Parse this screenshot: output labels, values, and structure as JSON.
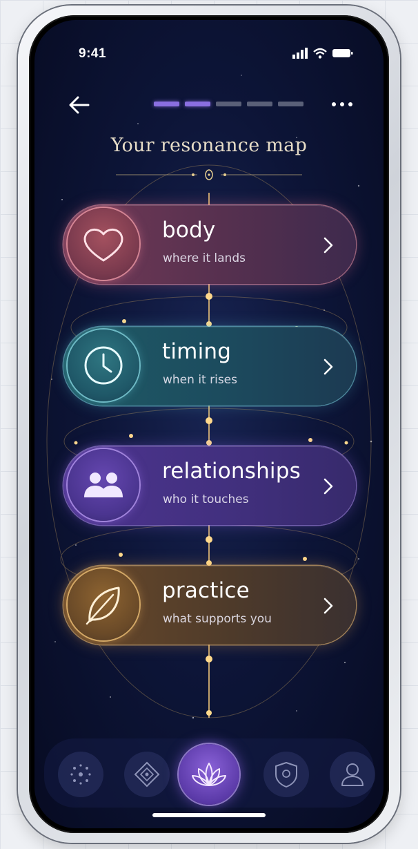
{
  "status_bar": {
    "time": "9:41"
  },
  "header": {
    "title": "Your resonance map",
    "progress": {
      "total_steps": 5,
      "completed_steps": 2
    }
  },
  "cards": [
    {
      "id": "body",
      "title": "body",
      "subtitle": "where it lands",
      "icon": "heart-icon",
      "accent": "#e58fa0"
    },
    {
      "id": "timing",
      "title": "timing",
      "subtitle": "when it rises",
      "icon": "clock-icon",
      "accent": "#7fd3da"
    },
    {
      "id": "relationships",
      "title": "relationships",
      "subtitle": "who it touches",
      "icon": "people-icon",
      "accent": "#b89af0"
    },
    {
      "id": "practice",
      "title": "practice",
      "subtitle": "what supports you",
      "icon": "leaf-icon",
      "accent": "#e6b46e"
    }
  ],
  "tab_bar": {
    "items": [
      {
        "icon": "sparkle-cluster-icon",
        "active": false
      },
      {
        "icon": "compass-diamond-icon",
        "active": false
      },
      {
        "icon": "lotus-icon",
        "active": true
      },
      {
        "icon": "shield-heart-icon",
        "active": false
      },
      {
        "icon": "profile-icon",
        "active": false
      }
    ]
  },
  "colors": {
    "background": "#0b1230",
    "title_text": "#e6dcc7",
    "progress_active": "#8a6fe0",
    "progress_inactive": "#5a6078"
  }
}
